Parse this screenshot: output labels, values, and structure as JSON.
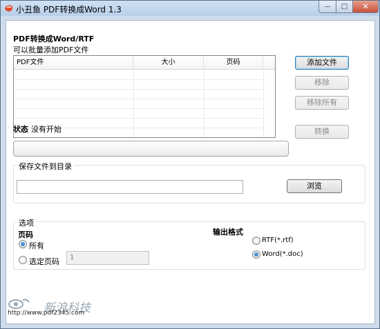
{
  "window": {
    "title": "小丑鱼 PDF转换成Word 1.3",
    "controls": {
      "minimize": "—",
      "maximize": "□",
      "close": "✕"
    }
  },
  "source": {
    "heading": "PDF转换成Word/RTF",
    "hint": "可以批量添加PDF文件",
    "columns": [
      "PDF文件",
      "大小",
      "页码"
    ],
    "rows": []
  },
  "buttons": {
    "add": "添加文件",
    "remove": "移除",
    "remove_all": "移除所有",
    "convert": "转换",
    "browse": "浏览"
  },
  "status": {
    "label": "状态",
    "value": "没有开始"
  },
  "progress": {
    "value": 0
  },
  "output_dir": {
    "group_title": "保存文件到目录",
    "value": ""
  },
  "options": {
    "group_title": "选项",
    "pages": {
      "heading": "页码",
      "all_label": "所有",
      "selected_label": "选定页码",
      "selected_pages_value": "1",
      "selected": "all"
    },
    "format": {
      "heading": "输出格式",
      "rtf_label": "RTF(*.rtf)",
      "doc_label": "Word(*.doc)",
      "selected": "doc"
    }
  },
  "watermark": {
    "brand": "新浪科技",
    "url": "http://www.pdf2345.com"
  }
}
